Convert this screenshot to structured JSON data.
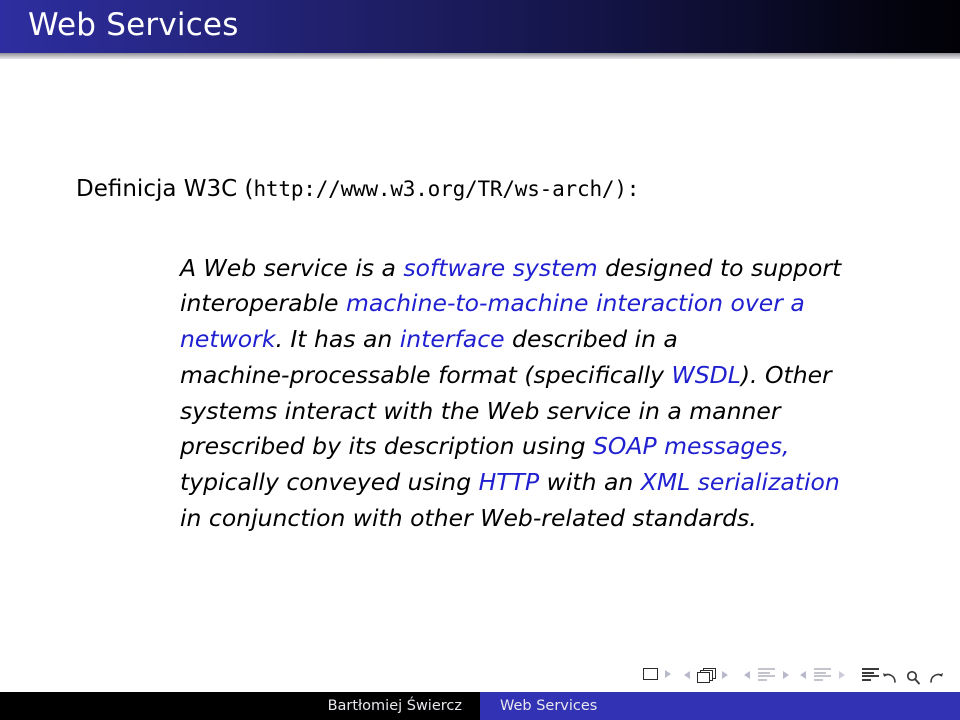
{
  "slide": {
    "title": "Web Services",
    "definition": {
      "label": "Definicja W3C (",
      "url": "http://www.w3.org/TR/ws-arch/",
      "suffix": "):"
    },
    "quote_lines": [
      [
        {
          "text": "A Web service is a ",
          "highlight": false
        },
        {
          "text": "software system",
          "highlight": true
        },
        {
          "text": " designed to support",
          "highlight": false
        }
      ],
      [
        {
          "text": "interoperable ",
          "highlight": false
        },
        {
          "text": "machine-to-machine interaction over a",
          "highlight": true
        }
      ],
      [
        {
          "text": "network",
          "highlight": true
        },
        {
          "text": ". It has an ",
          "highlight": false
        },
        {
          "text": "interface",
          "highlight": true
        },
        {
          "text": " described in a",
          "highlight": false
        }
      ],
      [
        {
          "text": "machine-processable format (specifically ",
          "highlight": false
        },
        {
          "text": "WSDL",
          "highlight": true
        },
        {
          "text": "). Other",
          "highlight": false
        }
      ],
      [
        {
          "text": "systems interact with the Web service in a manner",
          "highlight": false
        }
      ],
      [
        {
          "text": "prescribed by its description using ",
          "highlight": false
        },
        {
          "text": "SOAP messages,",
          "highlight": true
        }
      ],
      [
        {
          "text": "typically conveyed using ",
          "highlight": false
        },
        {
          "text": "HTTP",
          "highlight": true
        },
        {
          "text": " with an ",
          "highlight": false
        },
        {
          "text": "XML serialization",
          "highlight": true
        }
      ],
      [
        {
          "text": "in conjunction with other Web-related standards.",
          "highlight": false
        }
      ]
    ]
  },
  "footer": {
    "author": "Bartłomiej Świercz",
    "subject": "Web Services"
  },
  "navigation": {
    "icons": [
      "slide-rect-icon",
      "next-triangle-icon",
      "prev-triangle-icon",
      "frames-stack-icon",
      "next-triangle-icon",
      "prev-triangle-icon",
      "subsection-lines-icon",
      "next-triangle-icon",
      "prev-triangle-icon",
      "section-lines-icon"
    ],
    "controls": [
      "back-arrow-icon",
      "search-icon",
      "forward-arrow-icon"
    ]
  },
  "colors": {
    "title_gradient_start": "#2e2ea0",
    "title_gradient_end": "#010106",
    "highlight_blue": "#2020d0",
    "footer_blue": "#3232b4",
    "footer_black": "#000000"
  }
}
